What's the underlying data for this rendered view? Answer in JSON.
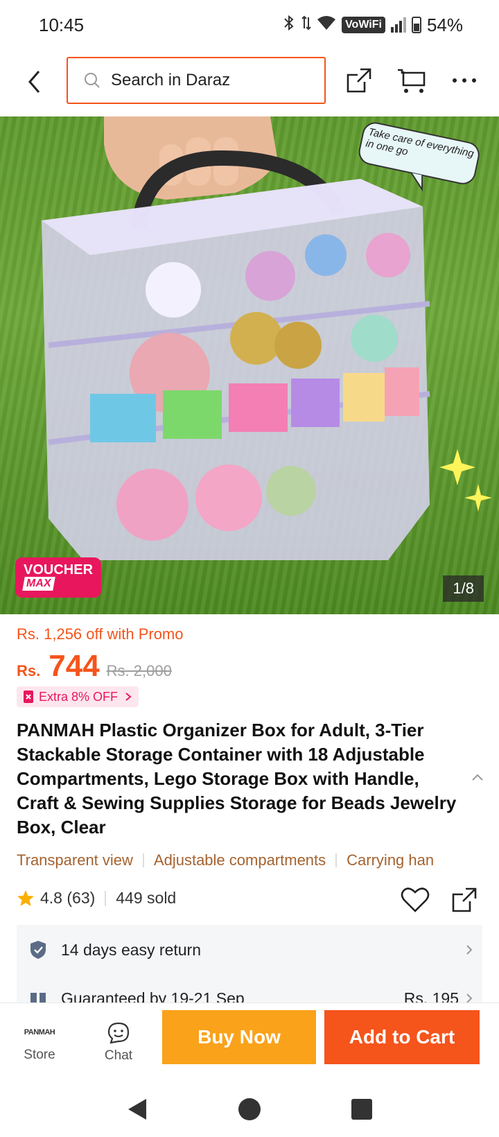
{
  "status_bar": {
    "time": "10:45",
    "network_label": "VoWiFi",
    "battery": "54%"
  },
  "header": {
    "search_placeholder": "Search in Daraz",
    "icons": [
      "back-arrow-icon",
      "search-icon",
      "share-icon",
      "cart-icon",
      "more-icon"
    ]
  },
  "gallery": {
    "speech_text": "Take care of everything in one go",
    "voucher_line1": "VOUCHER",
    "voucher_line2": "MAX",
    "counter": "1/8"
  },
  "price": {
    "promo": "Rs. 1,256 off with Promo",
    "currency": "Rs.",
    "value": "744",
    "original": "Rs. 2,000",
    "extra": "Extra 8% OFF"
  },
  "product": {
    "title": "PANMAH Plastic Organizer Box for Adult, 3-Tier Stackable Storage Container with 18 Adjustable Compartments, Lego Storage Box with Handle, Craft & Sewing Supplies Storage for Beads Jewelry Box, Clear",
    "tags": [
      "Transparent view",
      "Adjustable compartments",
      "Carrying han"
    ],
    "rating": "4.8 (63)",
    "sold": "449 sold"
  },
  "services": {
    "return_label": "14 days easy return",
    "delivery_label": "Guaranteed by 19-21 Sep",
    "delivery_fee": "Rs. 195"
  },
  "bottom_bar": {
    "store_logo": "PANMAH",
    "store_label": "Store",
    "chat_label": "Chat",
    "buy_now": "Buy Now",
    "add_to_cart": "Add to Cart"
  },
  "colors": {
    "accent": "#f5541b",
    "buy_now": "#faa21a",
    "voucher": "#e8175d",
    "tag_text": "#a5622e"
  }
}
